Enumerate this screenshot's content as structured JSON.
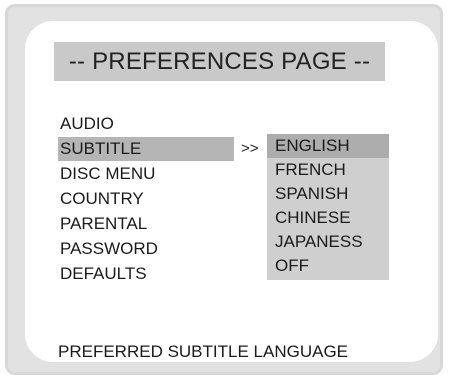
{
  "title": "-- PREFERENCES PAGE --",
  "menu": {
    "items": [
      {
        "label": "AUDIO"
      },
      {
        "label": "SUBTITLE"
      },
      {
        "label": "DISC MENU"
      },
      {
        "label": "COUNTRY"
      },
      {
        "label": "PARENTAL"
      },
      {
        "label": "PASSWORD"
      },
      {
        "label": "DEFAULTS"
      }
    ],
    "selected_index": 1
  },
  "arrow": ">>",
  "submenu": {
    "items": [
      {
        "label": "ENGLISH"
      },
      {
        "label": "FRENCH"
      },
      {
        "label": "SPANISH"
      },
      {
        "label": "CHINESE"
      },
      {
        "label": "JAPANESS"
      },
      {
        "label": "OFF"
      }
    ],
    "selected_index": 0
  },
  "footer": "PREFERRED SUBTITLE LANGUAGE",
  "colors": {
    "frame": "#e2e2e2",
    "panel": "#ffffff",
    "title_bar": "#c9c9c9",
    "menu_highlight": "#b5b5b5",
    "submenu_bg": "#cfcfcf",
    "submenu_highlight": "#adadad"
  }
}
